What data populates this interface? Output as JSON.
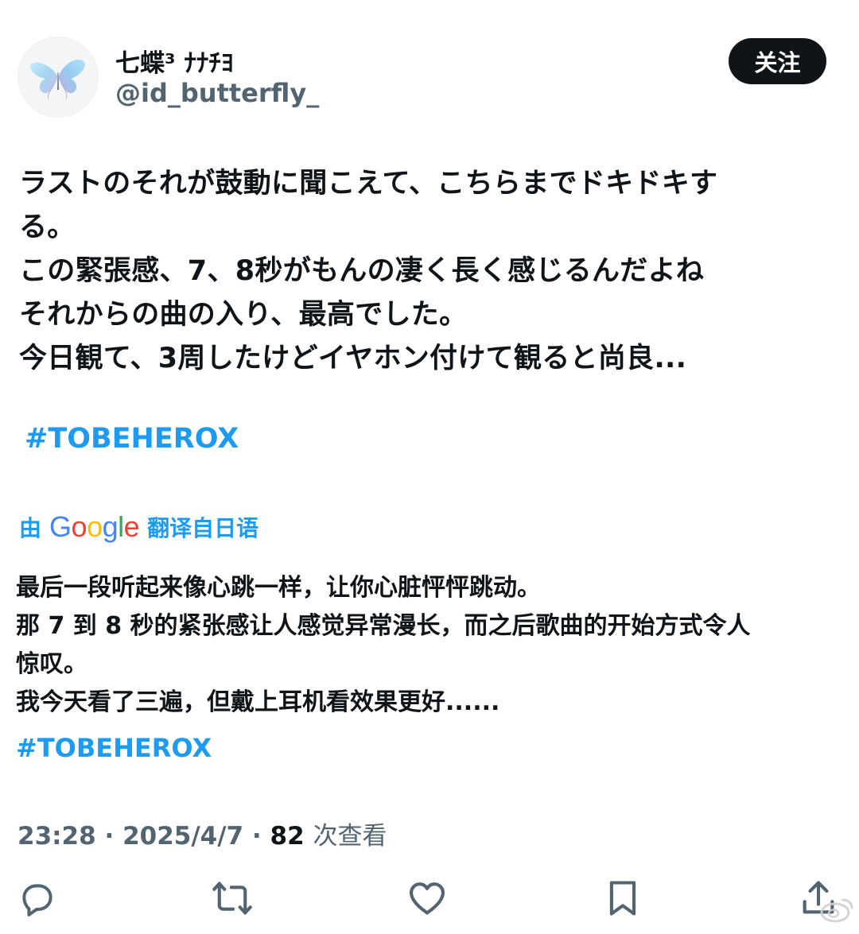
{
  "profile": {
    "display_name": "七蝶³ ﾅﾅﾁﾖ",
    "handle": "@id_butterfly_",
    "avatar_icon": "butterfly-avatar-icon"
  },
  "follow_button": {
    "label": "关注"
  },
  "tweet": {
    "lines": [
      "ラストのそれが鼓動に聞こえて、こちらまでドキドキす",
      "る。",
      "この緊張感、7、8秒がもんの凄く長く感じるんだよね",
      "それからの曲の入り、最高でした。",
      "今日観て、3周したけどイヤホン付けて観ると尚良..."
    ],
    "hashtag": "#TOBEHEROX"
  },
  "translation": {
    "prefix": "由",
    "provider": "Google",
    "suffix": "翻译自日语",
    "lines": [
      "最后一段听起来像心跳一样，让你心脏怦怦跳动。",
      "那 7 到 8 秒的紧张感让人感觉异常漫长，而之后歌曲的开始方式令人",
      "惊叹。",
      "我今天看了三遍，但戴上耳机看效果更好......"
    ],
    "hashtag": "#TOBEHEROX"
  },
  "meta": {
    "time": "23:28",
    "separator": " · ",
    "date": "2025/4/7",
    "views_count": "82",
    "views_label": "次查看"
  },
  "actions": [
    {
      "name": "reply",
      "icon": "reply-icon"
    },
    {
      "name": "retweet",
      "icon": "retweet-icon"
    },
    {
      "name": "like",
      "icon": "heart-icon"
    },
    {
      "name": "bookmark",
      "icon": "bookmark-icon"
    },
    {
      "name": "share",
      "icon": "share-icon"
    }
  ],
  "colors": {
    "text": "#0f1419",
    "secondary": "#536471",
    "link": "#1d9bf0",
    "follow_bg": "#0f1419",
    "google_blue": "#4285f4",
    "google_red": "#ea4335",
    "google_yellow": "#fbbc05",
    "google_green": "#34a853"
  }
}
